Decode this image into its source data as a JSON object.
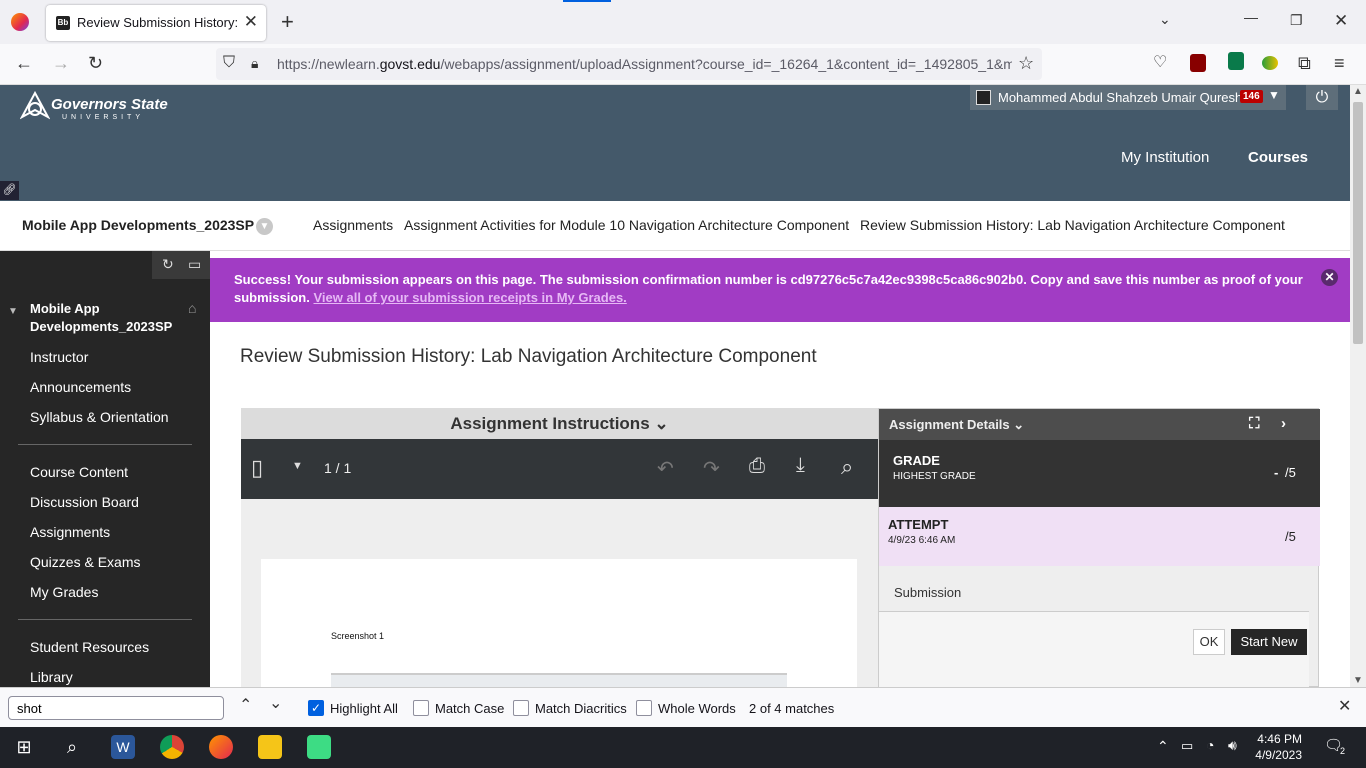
{
  "browser": {
    "tab_title": "Review Submission History: Lab",
    "tab_favicon": "Bb",
    "url_prefix": "https://newlearn.",
    "url_domain": "govst.edu",
    "url_path": "/webapps/assignment/uploadAssignment?course_id=_16264_1&content_id=_1492805_1&m"
  },
  "header": {
    "logo_line1": "Governors State",
    "logo_line2": "UNIVERSITY",
    "user_name": "Mohammed Abdul Shahzeb Umair Qureshi",
    "notification_count": "146",
    "nav_institution": "My Institution",
    "nav_courses": "Courses"
  },
  "breadcrumbs": {
    "course": "Mobile App Developments_2023SP",
    "items": [
      "Assignments",
      "Assignment Activities for Module 10 Navigation Architecture Component",
      "Review Submission History: Lab Navigation Architecture Component"
    ]
  },
  "sidebar": {
    "course_title": "Mobile App Developments_2023SP",
    "group1": [
      "Instructor",
      "Announcements",
      "Syllabus & Orientation"
    ],
    "group2": [
      "Course Content",
      "Discussion Board",
      "Assignments",
      "Quizzes & Exams",
      "My Grades"
    ],
    "group3": [
      "Student Resources",
      "Library"
    ]
  },
  "banner": {
    "message": "Success! Your submission appears on this page. The submission confirmation number is cd97276c5c7a42ec9398c5ca86c902b0. Copy and save this number as proof of your submission.",
    "link": "View all of your submission receipts in My Grades."
  },
  "main": {
    "page_title": "Review Submission History: Lab Navigation Architecture Component",
    "instructions_header": "Assignment Instructions",
    "page_indicator": "1 / 1",
    "doc_caption": "Screenshot 1"
  },
  "details": {
    "header": "Assignment Details",
    "grade_label": "GRADE",
    "grade_sub": "HIGHEST GRADE",
    "grade_value": "-",
    "grade_total": "/5",
    "attempt_label": "ATTEMPT",
    "attempt_date": "4/9/23 6:46 AM",
    "attempt_total": "/5",
    "submission_label": "Submission",
    "ok_label": "OK",
    "start_new_label": "Start New"
  },
  "findbar": {
    "query": "shot",
    "highlight_all": "Highlight All",
    "match_case": "Match Case",
    "match_diacritics": "Match Diacritics",
    "whole_words": "Whole Words",
    "result": "2 of 4 matches"
  },
  "taskbar": {
    "time": "4:46 PM",
    "date": "4/9/2023",
    "notifications": "2"
  },
  "colors": {
    "header_bg": "#44596a",
    "banner_bg": "#a13cc4",
    "sidebar_bg": "#262626",
    "firefox_blue": "#0060df"
  }
}
